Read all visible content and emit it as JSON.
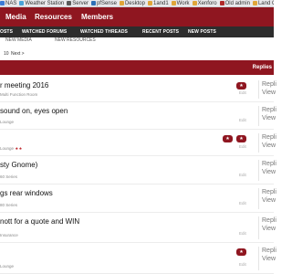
{
  "bookmarks": [
    {
      "label": "NAS",
      "color": "#3b7bd6"
    },
    {
      "label": "Weather Station",
      "color": "#4aa3d8"
    },
    {
      "label": "Server",
      "color": "#5a5a5a"
    },
    {
      "label": "pfSense",
      "color": "#2e6fb5"
    },
    {
      "label": "Desktop",
      "color": "#e0a63a"
    },
    {
      "label": "1and1",
      "color": "#e0a63a"
    },
    {
      "label": "Work",
      "color": "#e0a63a"
    },
    {
      "label": "Xenforo",
      "color": "#e0a63a"
    },
    {
      "label": "Old admin",
      "color": "#b02a2a"
    },
    {
      "label": "Land Cruiser",
      "color": "#e0a63a"
    }
  ],
  "nav": {
    "tabs": [
      {
        "label": "Media"
      },
      {
        "label": "Resources"
      },
      {
        "label": "Members"
      }
    ],
    "subtabs": [
      {
        "label": "OSTS"
      },
      {
        "label": "WATCHED FORUMS"
      },
      {
        "label": "WATCHED THREADS"
      },
      {
        "label": "RECENT POSTS"
      },
      {
        "label": "NEW POSTS"
      }
    ],
    "strip_links": [
      {
        "label": "NEW MEDIA"
      },
      {
        "label": "NEW RESOURCES"
      }
    ]
  },
  "pager": {
    "page": "10",
    "next": "Next >"
  },
  "list_header": {
    "replies": "Replies"
  },
  "threads": [
    {
      "title": "r meeting 2016",
      "meta": "Multi Function Room",
      "badges": 1,
      "edit": "Edit",
      "replies": "Repli",
      "views": "View"
    },
    {
      "title": "sound on, eyes open",
      "meta": "Lounge",
      "badges": 0,
      "edit": "Edit",
      "replies": "Repli",
      "views": "View"
    },
    {
      "title": "",
      "meta": "Lounge",
      "flame": "♠ ♠",
      "badges": 2,
      "edit": "Edit",
      "replies": "Repli",
      "views": "View"
    },
    {
      "title": "sty Gnome)",
      "meta": "60 Series",
      "badges": 0,
      "edit": "Edit",
      "replies": "Repli",
      "views": "View"
    },
    {
      "title": "gs rear windows",
      "meta": "80 Series",
      "badges": 0,
      "edit": "Edit",
      "replies": "Repli",
      "views": "View"
    },
    {
      "title": "nott for a quote and WIN",
      "meta": "Insurance",
      "badges": 0,
      "edit": "Edit",
      "replies": "Repli",
      "views": "View"
    },
    {
      "title": "",
      "meta": "Lounge",
      "badges": 1,
      "edit": "Edit",
      "replies": "Repli",
      "views": "View"
    }
  ]
}
